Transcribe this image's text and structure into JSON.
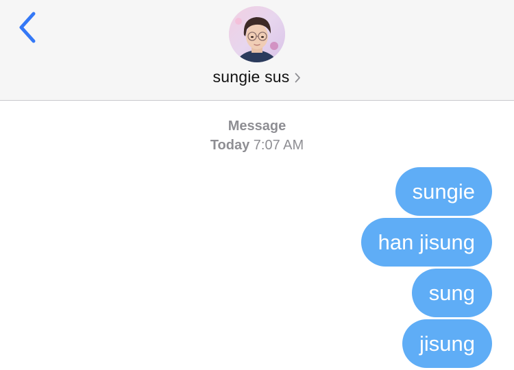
{
  "header": {
    "contact_name": "sungie sus",
    "back_icon": "chevron-left-icon",
    "disclosure_icon": "chevron-right-icon",
    "accent_color": "#3478f6"
  },
  "conversation": {
    "service_label": "Message",
    "day_label": "Today",
    "time_label": "7:07 AM"
  },
  "messages": [
    {
      "text": "sungie",
      "direction": "outgoing"
    },
    {
      "text": "han jisung",
      "direction": "outgoing"
    },
    {
      "text": "sung",
      "direction": "outgoing"
    },
    {
      "text": "jisung",
      "direction": "outgoing"
    }
  ],
  "colors": {
    "bubble": "#5fadf6",
    "bubble_text": "#ffffff",
    "header_bg": "#f6f6f6",
    "meta_text": "#8e8e93"
  }
}
